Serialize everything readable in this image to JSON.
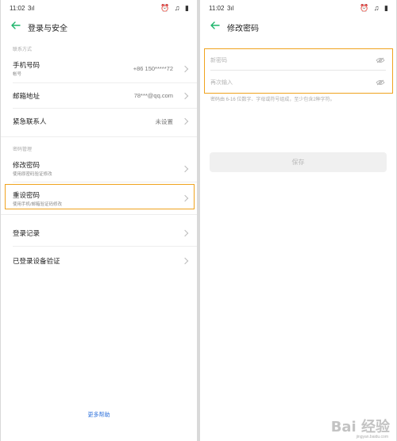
{
  "status_bar": {
    "time": "11:02",
    "signal": "3ıl",
    "icons": "⏰ ♫ ▮"
  },
  "accent_color": "#1fb56b",
  "highlight_color": "#f0a31e",
  "left_screen": {
    "title": "登录与安全",
    "section_contact": "联系方式",
    "phone_label": "手机号码",
    "phone_sub": "帐号",
    "phone_value": "+86 150*****72",
    "email_label": "邮箱地址",
    "email_value": "78***@qq.com",
    "emergency_label": "紧急联系人",
    "emergency_value": "未设置",
    "section_password": "密码管理",
    "change_pw_label": "修改密码",
    "change_pw_sub": "使用原密码验证修改",
    "reset_pw_label": "重设密码",
    "reset_pw_sub": "使用手机/邮箱验证码修改",
    "login_records_label": "登录记录",
    "device_verify_label": "已登录设备验证",
    "more_help": "更多帮助"
  },
  "right_screen": {
    "title": "修改密码",
    "new_password_placeholder": "新密码",
    "confirm_placeholder": "再次输入",
    "hint": "密码由 6-16 位数字、字母或符号组成，至少包含2种字符。",
    "save_label": "保存"
  },
  "watermark": {
    "brand": "Bai 经验",
    "url": "jingyan.baidu.com"
  }
}
